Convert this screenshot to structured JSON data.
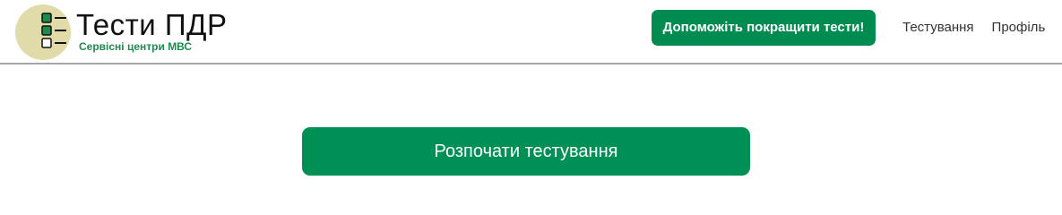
{
  "header": {
    "logo": {
      "title": "Тести ПДР",
      "subtitle": "Сервісні центри МВС",
      "icon": "checklist-icon",
      "colors": {
        "circle": "#e0dba8",
        "check": "#1f8a4e"
      }
    },
    "help_button_label": "Допоможіть покращити тести!",
    "nav": [
      {
        "label": "Тестування"
      },
      {
        "label": "Профіль"
      }
    ]
  },
  "main": {
    "start_button_label": "Розпочати тестування"
  },
  "colors": {
    "accent": "#008f55",
    "divider": "#a6a6a6",
    "nav_text": "#333333"
  }
}
